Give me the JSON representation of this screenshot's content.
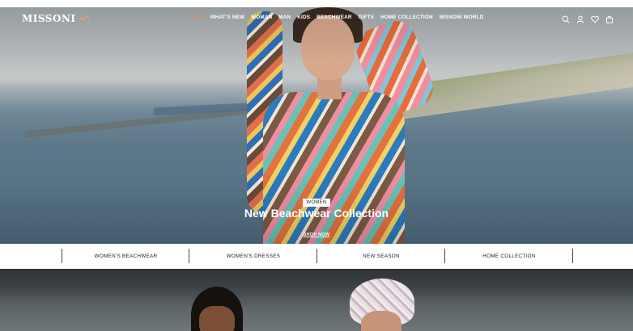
{
  "brand": {
    "logo_text": "MISSONI"
  },
  "nav": {
    "items": [
      "SALE",
      "WHAT'S NEW",
      "WOMAN",
      "MAN",
      "KIDS",
      "BEACHWEAR",
      "GIFTS",
      "HOME COLLECTION",
      "MISSONI WORLD"
    ],
    "icons": [
      "search-icon",
      "account-icon",
      "wishlist-heart-icon",
      "shopping-bag-icon"
    ]
  },
  "hero": {
    "badge": "WOMEN",
    "title": "New Beachwear Collection",
    "cta": "SHOP NOW"
  },
  "categories": [
    "WOMEN'S BEACHWEAR",
    "WOMEN'S DRESSES",
    "NEW SEASON",
    "HOME COLLECTION"
  ],
  "colors": {
    "sale": "#e08a6b",
    "text_light": "#ffffff",
    "text_dark": "#222222"
  }
}
